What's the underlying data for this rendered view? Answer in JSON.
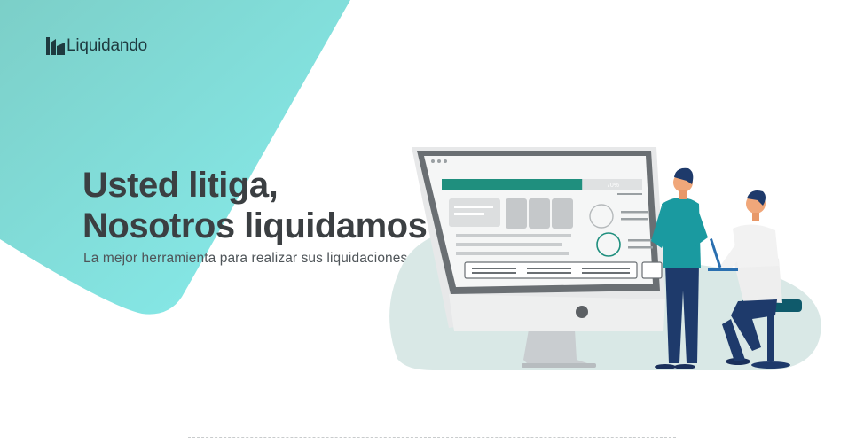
{
  "brand": {
    "name": "Liquidando",
    "logo_icon": "liquidando-logo-icon"
  },
  "hero": {
    "headline_line1": "Usted litiga,",
    "headline_line2": "Nosotros liquidamos",
    "subtitle": "La mejor herramienta para realizar sus liquidaciones."
  },
  "illustration": {
    "progress_label": "70%",
    "progress_value": 0.7
  },
  "colors": {
    "teal_start": "#7fd2cb",
    "teal_end": "#86ecec",
    "accent_green": "#1f8f7e",
    "dark_navy": "#1e3a6b",
    "headline": "#3b3f42"
  }
}
